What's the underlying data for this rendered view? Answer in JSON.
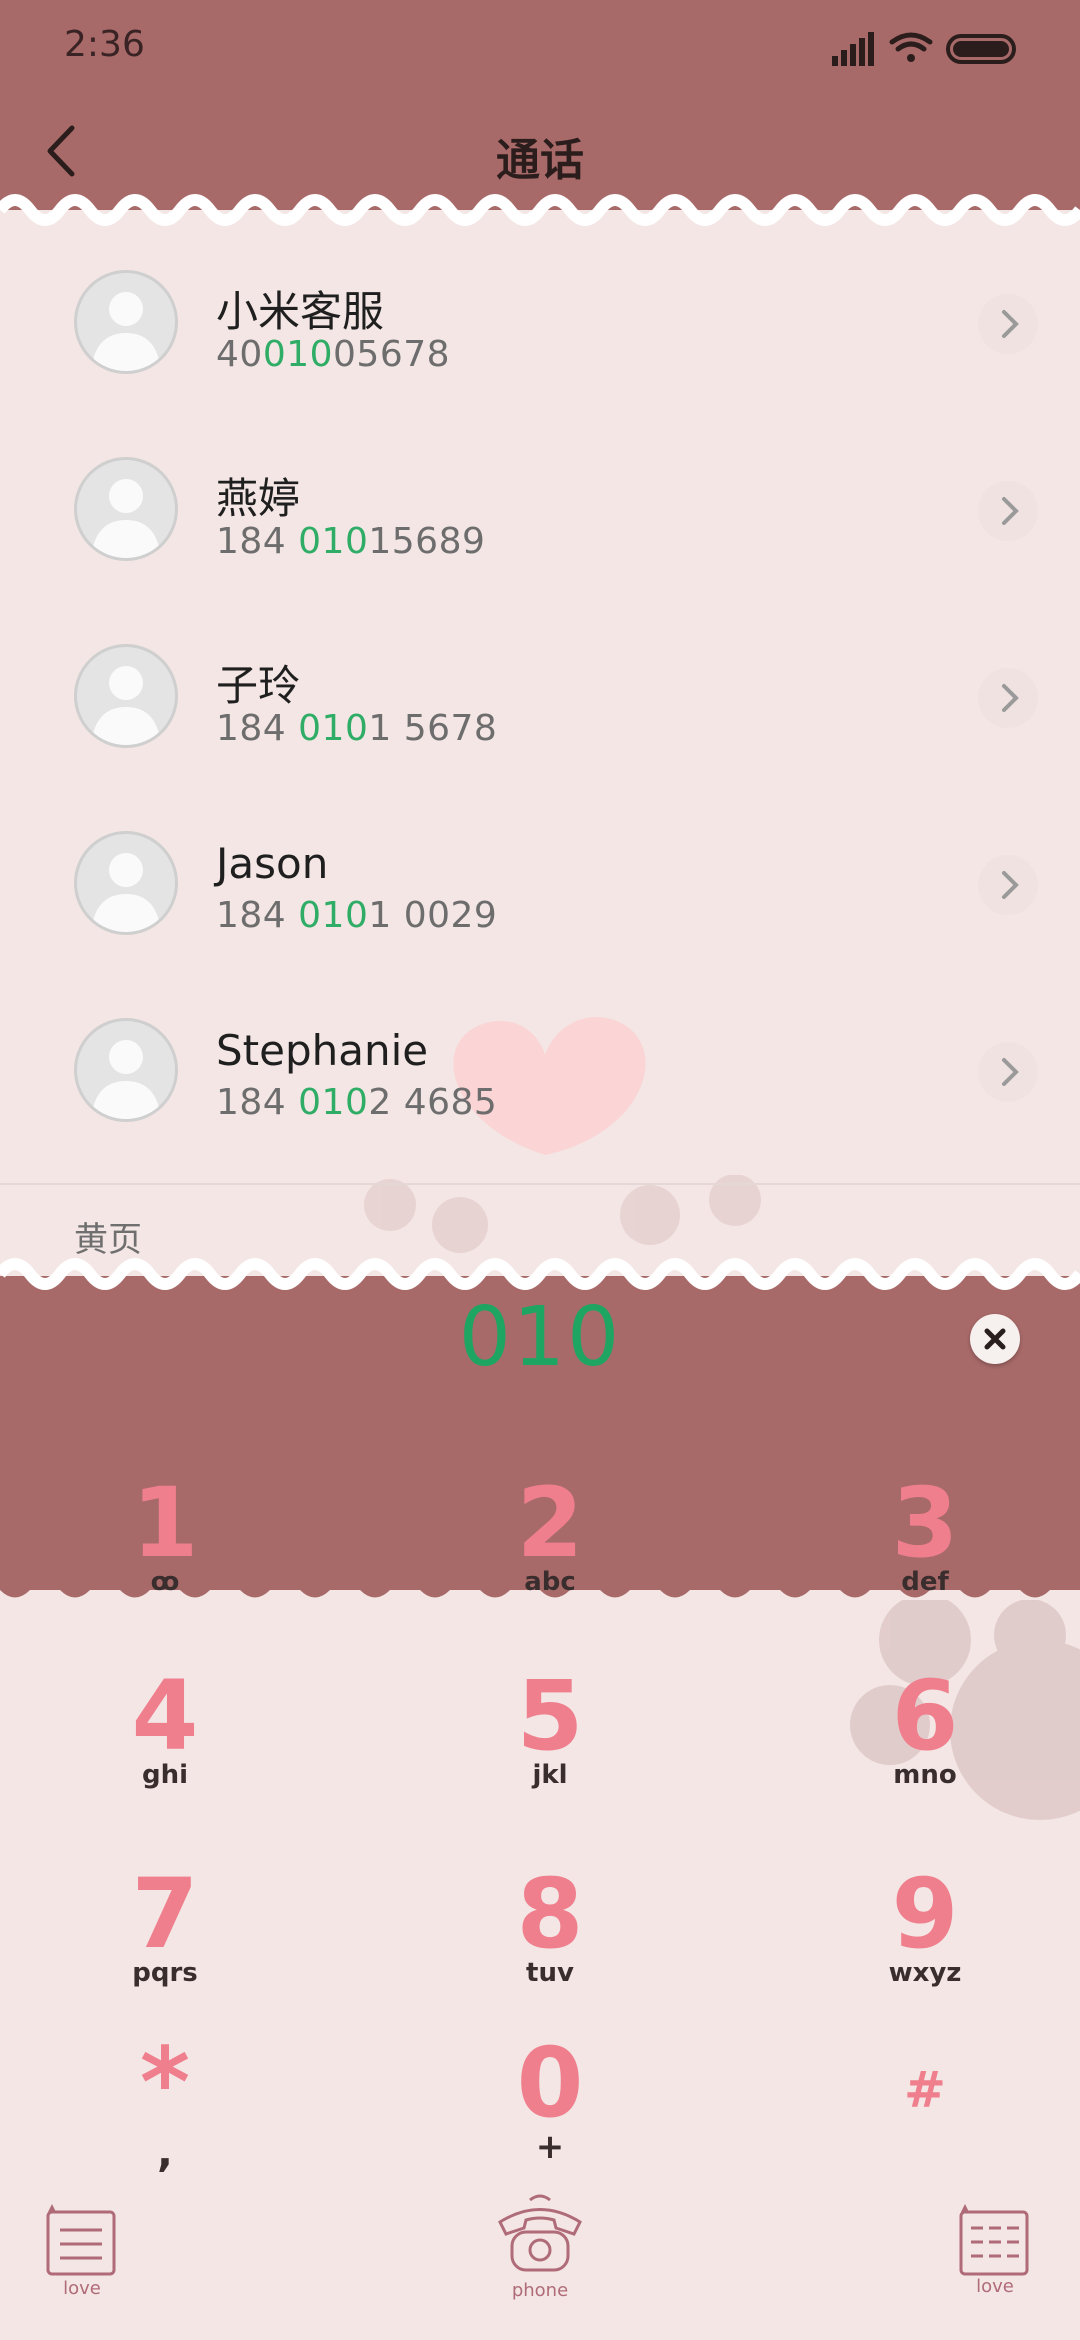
{
  "status_bar": {
    "time": "2:36"
  },
  "header": {
    "title": "通话"
  },
  "contacts": [
    {
      "name": "小米客服",
      "number_parts": [
        "40",
        "010",
        "05678"
      ]
    },
    {
      "name": "燕婷",
      "number_parts": [
        "184 ",
        "010",
        "15689"
      ]
    },
    {
      "name": "子玲",
      "number_parts": [
        "184 ",
        "010",
        "1 5678"
      ]
    },
    {
      "name": "Jason",
      "number_parts": [
        "184 ",
        "010",
        "1 0029"
      ]
    },
    {
      "name": "Stephanie",
      "number_parts": [
        "184 ",
        "010",
        "2 4685"
      ]
    }
  ],
  "section": {
    "label": "黄页"
  },
  "dialer": {
    "input": "010",
    "keys": [
      {
        "digit": "1",
        "letters": "ꝏ"
      },
      {
        "digit": "2",
        "letters": "abc"
      },
      {
        "digit": "3",
        "letters": "def"
      },
      {
        "digit": "4",
        "letters": "ghi"
      },
      {
        "digit": "5",
        "letters": "jkl"
      },
      {
        "digit": "6",
        "letters": "mno"
      },
      {
        "digit": "7",
        "letters": "pqrs"
      },
      {
        "digit": "8",
        "letters": "tuv"
      },
      {
        "digit": "9",
        "letters": "wxyz"
      },
      {
        "digit": "*",
        "letters": ","
      },
      {
        "digit": "0",
        "letters": "+"
      },
      {
        "digit": "#",
        "letters": ""
      }
    ]
  },
  "bottom_bar": {
    "left_label": "love",
    "center_label": "phone",
    "right_label": "love"
  },
  "colors": {
    "header_bg": "#a86a69",
    "page_bg": "#f3e6e4",
    "highlight_green": "#2fad66",
    "key_pink": "#f07f8e"
  },
  "icons": {
    "back": "chevron-left-icon",
    "row_action": "chevron-right-icon",
    "clear": "close-icon",
    "left_bottom": "menu-icon",
    "center_bottom": "telephone-icon",
    "right_bottom": "dialpad-icon"
  }
}
